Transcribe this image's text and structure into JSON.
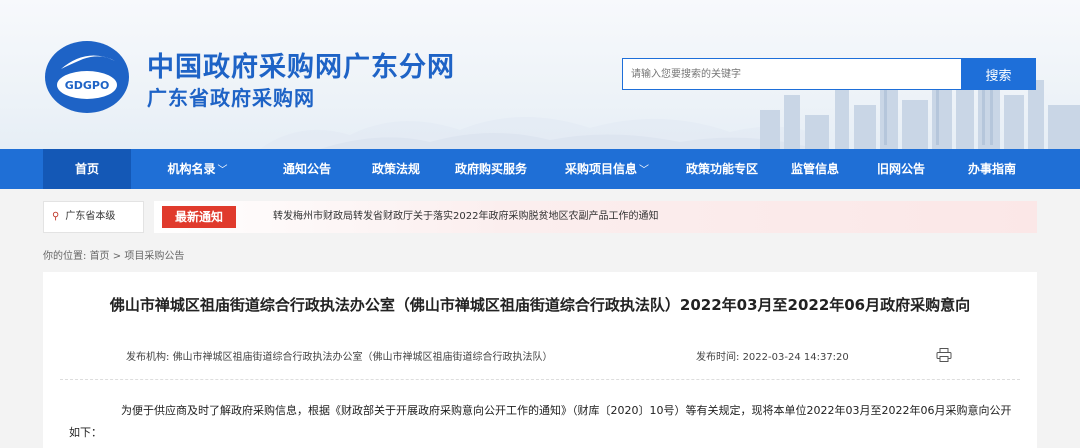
{
  "header": {
    "title": "中国政府采购网广东分网",
    "subtitle": "广东省政府采购网",
    "logo_text": "GDGPO"
  },
  "search": {
    "placeholder": "请输入您要搜索的关键字",
    "button_label": "搜索"
  },
  "nav": {
    "items": [
      {
        "label": "首页"
      },
      {
        "label": "机构名录",
        "caret": "﹀"
      },
      {
        "label": "通知公告"
      },
      {
        "label": "政策法规"
      },
      {
        "label": "政府购买服务"
      },
      {
        "label": "采购项目信息",
        "caret": "﹀"
      },
      {
        "label": "政策功能专区"
      },
      {
        "label": "监管信息"
      },
      {
        "label": "旧网公告"
      },
      {
        "label": "办事指南"
      }
    ]
  },
  "location": {
    "label": "广东省本级"
  },
  "ticker": {
    "badge": "最新通知",
    "text": "转发梅州市财政局转发省财政厅关于落实2022年政府采购脱贫地区农副产品工作的通知"
  },
  "breadcrumb": {
    "prefix": "你的位置:",
    "home": "首页",
    "sep": ">",
    "current": "项目采购公告"
  },
  "article": {
    "title": "佛山市禅城区祖庙街道综合行政执法办公室（佛山市禅城区祖庙街道综合行政执法队）2022年03月至2022年06月政府采购意向",
    "publisher_label": "发布机构:",
    "publisher": "佛山市禅城区祖庙街道综合行政执法办公室（佛山市禅城区祖庙街道综合行政执法队）",
    "time_label": "发布时间:",
    "time": "2022-03-24 14:37:20",
    "body": "为便于供应商及时了解政府采购信息，根据《财政部关于开展政府采购意向公开工作的通知》（财库〔2020〕10号）等有关规定，现将本单位2022年03月至2022年06月采购意向公开如下："
  },
  "colors": {
    "brand_blue": "#1e63c6",
    "nav_blue": "#1f6fd6",
    "nav_active": "#1458b6",
    "notice_red": "#e03a2c"
  }
}
